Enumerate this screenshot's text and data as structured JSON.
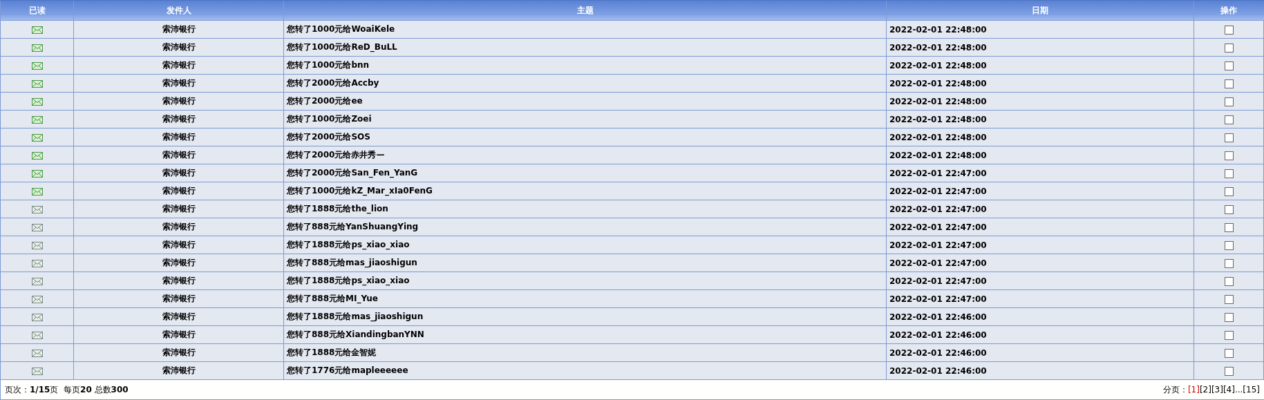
{
  "table": {
    "columns": [
      "已读",
      "发件人",
      "主题",
      "日期",
      "操作"
    ],
    "rows": [
      {
        "read": true,
        "sender": "索沛银行",
        "subject": "您转了1000元给WoaiKele",
        "date": "2022-02-01 22:48:00",
        "checked": false
      },
      {
        "read": true,
        "sender": "索沛银行",
        "subject": "您转了1000元给ReD_BuLL",
        "date": "2022-02-01 22:48:00",
        "checked": false
      },
      {
        "read": true,
        "sender": "索沛银行",
        "subject": "您转了1000元给bnn",
        "date": "2022-02-01 22:48:00",
        "checked": false
      },
      {
        "read": true,
        "sender": "索沛银行",
        "subject": "您转了2000元给Accby",
        "date": "2022-02-01 22:48:00",
        "checked": false
      },
      {
        "read": true,
        "sender": "索沛银行",
        "subject": "您转了2000元给ee",
        "date": "2022-02-01 22:48:00",
        "checked": false
      },
      {
        "read": true,
        "sender": "索沛银行",
        "subject": "您转了1000元给Zoei",
        "date": "2022-02-01 22:48:00",
        "checked": false
      },
      {
        "read": true,
        "sender": "索沛银行",
        "subject": "您转了2000元给SOS",
        "date": "2022-02-01 22:48:00",
        "checked": false
      },
      {
        "read": true,
        "sender": "索沛银行",
        "subject": "您转了2000元给赤井秀—",
        "date": "2022-02-01 22:48:00",
        "checked": false
      },
      {
        "read": true,
        "sender": "索沛银行",
        "subject": "您转了2000元给San_Fen_YanG",
        "date": "2022-02-01 22:47:00",
        "checked": false
      },
      {
        "read": true,
        "sender": "索沛银行",
        "subject": "您转了1000元给kZ_Mar_xIa0FenG",
        "date": "2022-02-01 22:47:00",
        "checked": false
      },
      {
        "read": false,
        "sender": "索沛银行",
        "subject": "您转了1888元给the_lion",
        "date": "2022-02-01 22:47:00",
        "checked": false
      },
      {
        "read": false,
        "sender": "索沛银行",
        "subject": "您转了888元给YanShuangYing",
        "date": "2022-02-01 22:47:00",
        "checked": false
      },
      {
        "read": false,
        "sender": "索沛银行",
        "subject": "您转了1888元给ps_xiao_xiao",
        "date": "2022-02-01 22:47:00",
        "checked": false
      },
      {
        "read": false,
        "sender": "索沛银行",
        "subject": "您转了888元给mas_jiaoshigun",
        "date": "2022-02-01 22:47:00",
        "checked": false
      },
      {
        "read": false,
        "sender": "索沛银行",
        "subject": "您转了1888元给ps_xiao_xiao",
        "date": "2022-02-01 22:47:00",
        "checked": false
      },
      {
        "read": false,
        "sender": "索沛银行",
        "subject": "您转了888元给MI_Yue",
        "date": "2022-02-01 22:47:00",
        "checked": false
      },
      {
        "read": false,
        "sender": "索沛银行",
        "subject": "您转了1888元给mas_jiaoshigun",
        "date": "2022-02-01 22:46:00",
        "checked": false
      },
      {
        "read": false,
        "sender": "索沛银行",
        "subject": "您转了888元给XiandingbanYNN",
        "date": "2022-02-01 22:46:00",
        "checked": false
      },
      {
        "read": false,
        "sender": "索沛银行",
        "subject": "您转了1888元给金智妮",
        "date": "2022-02-01 22:46:00",
        "checked": false
      },
      {
        "read": false,
        "sender": "索沛银行",
        "subject": "您转了1776元给mapleeeeee",
        "date": "2022-02-01 22:46:00",
        "checked": false
      }
    ]
  },
  "footer": {
    "summary": "页次：**1/15**页  每页**20** 总数**300**",
    "pagination_label": "分页：",
    "pages": [
      {
        "label": "[1]",
        "selected": true
      },
      {
        "label": "[2]",
        "selected": false
      },
      {
        "label": "[3]",
        "selected": false
      },
      {
        "label": "[4]",
        "selected": false
      },
      {
        "label": "...",
        "selected": false
      },
      {
        "label": "[15]",
        "selected": false
      }
    ]
  }
}
